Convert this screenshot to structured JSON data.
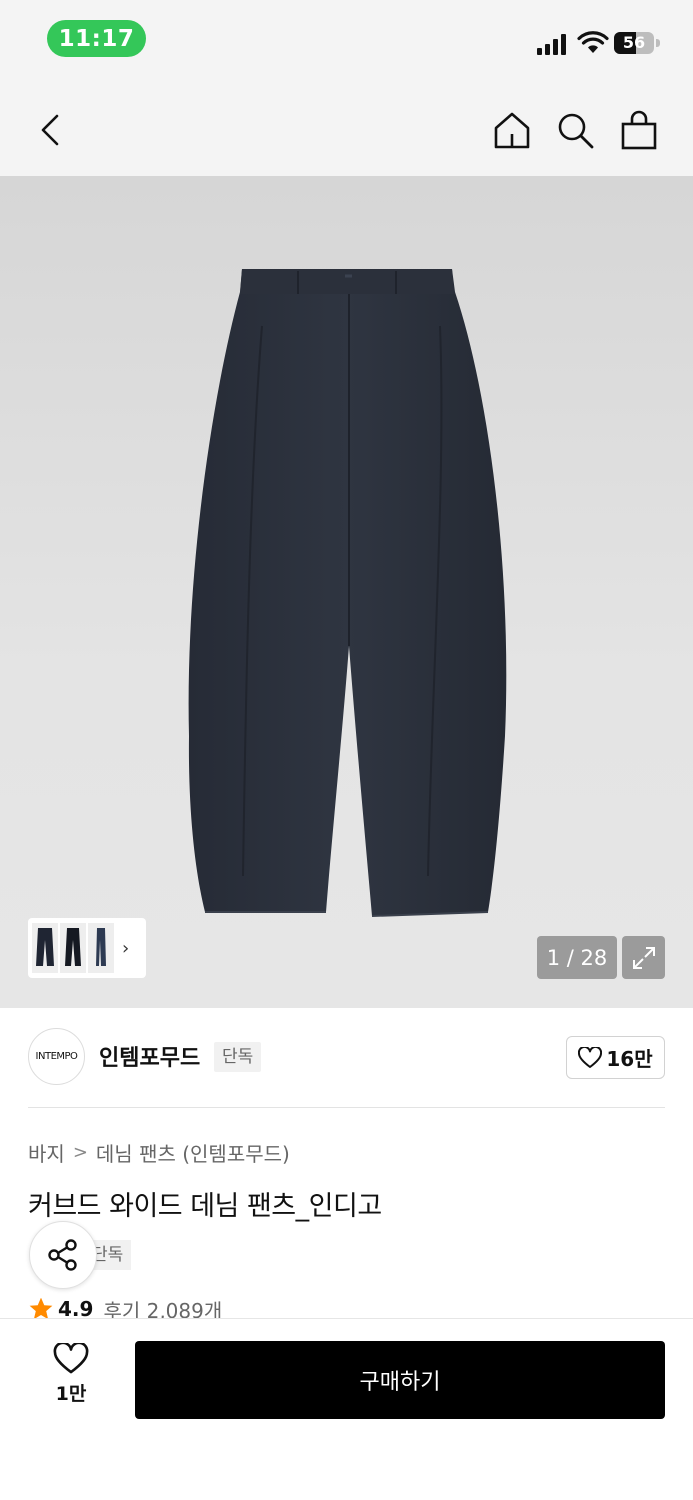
{
  "status_bar": {
    "time": "11:17",
    "battery": "56",
    "battery_level": 0.56
  },
  "nav": {
    "back_icon": "chevron-left-icon",
    "home_icon": "home-icon",
    "search_icon": "search-icon",
    "cart_icon": "shopping-bag-icon"
  },
  "gallery": {
    "counter": "1 / 28",
    "current": 1,
    "total": 28
  },
  "brand": {
    "logo_text": "INTEMPO",
    "name": "인템포무드",
    "badge": "단독",
    "likes": "16만"
  },
  "product": {
    "breadcrumb": [
      "바지",
      "데님 팬츠 (인템포무드)"
    ],
    "title": "커브드 와이드 데님 팬츠_인디고",
    "tag": "단독",
    "rating": "4.9",
    "reviews": "후기 2,089개"
  },
  "bottom": {
    "wish_count": "1만",
    "buy_label": "구매하기"
  },
  "colors": {
    "time_pill": "#34c759",
    "buy_button": "#000000",
    "star": "#ff8a00",
    "denim": "#2a2f3a"
  }
}
